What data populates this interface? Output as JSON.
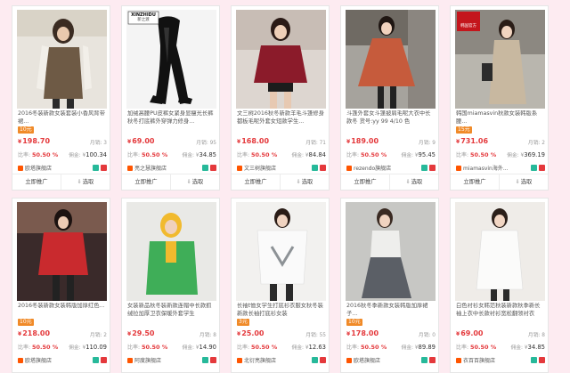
{
  "ui": {
    "commission_ratio_label": "比率:",
    "monthly_sales_label": "月销:",
    "commission_label": "佣金:",
    "promote_button": "立即推广",
    "select_button": "选取"
  },
  "products": [
    {
      "title": "2016冬装新款女装套装小香风背带裙...",
      "badge": "10元",
      "price": "198.70",
      "monthly_sales": "3",
      "ratio": "50.50 %",
      "commission": "100.34",
      "shop": "欧塔旗舰店",
      "has_badge": true
    },
    {
      "title": "加绒高腰PU皮裤女紧身显瘦光长裤秋冬打底裤外穿弹力修身...",
      "badge": "",
      "price": "69.00",
      "monthly_sales": "95",
      "ratio": "50.50 %",
      "commission": "34.85",
      "shop": "亮之慧旗舰店",
      "has_badge": false
    },
    {
      "title": "文三树2016秋冬新款羊毛斗篷修身都板毛呢外套女短款学生...",
      "badge": "",
      "price": "168.00",
      "monthly_sales": "71",
      "ratio": "50.50 %",
      "commission": "84.84",
      "shop": "文三树旗舰店",
      "has_badge": false
    },
    {
      "title": "斗篷外套女斗篷披肩毛呢大衣中长款冬 货号:yy 99 4/10 色",
      "badge": "",
      "price": "189.00",
      "monthly_sales": "9",
      "ratio": "50.50 %",
      "commission": "95.45",
      "shop": "rezendo旗舰店",
      "has_badge": false
    },
    {
      "title": "韩国miamasvin秋款女装韩版系腰...",
      "badge": "15元",
      "price": "731.06",
      "monthly_sales": "2",
      "ratio": "50.50 %",
      "commission": "369.19",
      "shop": "miamasvin海外...",
      "has_badge": true
    },
    {
      "title": "2016冬装新款女装韩版加厚红色...",
      "badge": "10元",
      "price": "218.00",
      "monthly_sales": "2",
      "ratio": "50.50 %",
      "commission": "110.09",
      "shop": "欧塔旗舰店",
      "has_badge": true
    },
    {
      "title": "女装新品秋冬装新款连帽中长款抓绒拉加厚卫衣保暖外套学生",
      "badge": "",
      "price": "29.50",
      "monthly_sales": "8",
      "ratio": "50.50 %",
      "commission": "14.90",
      "shop": "阿度旗舰店",
      "has_badge": false
    },
    {
      "title": "长袖t恤女学生打底衫衣服女秋冬装新款长袖打底衫女装",
      "badge": "3元",
      "price": "25.00",
      "monthly_sales": "55",
      "ratio": "50.50 %",
      "commission": "12.63",
      "shop": "北衍亮旗舰店",
      "has_badge": true
    },
    {
      "title": "2016秋冬季新款女装韩版加厚裙子...",
      "badge": "10元",
      "price": "178.00",
      "monthly_sales": "0",
      "ratio": "50.50 %",
      "commission": "89.89",
      "shop": "欧塔旗舰店",
      "has_badge": true
    },
    {
      "title": "白色衬衫女韩范秋装新款秋季新长袖上衣中长款衬衫宽松翻领衬衣",
      "badge": "",
      "price": "69.00",
      "monthly_sales": "8",
      "ratio": "50.50 %",
      "commission": "34.85",
      "shop": "衣百百旗舰店",
      "has_badge": false
    }
  ],
  "image_overlays": {
    "logo_text": "XINZHIDU",
    "logo_subtext": "新之渡",
    "flag_text": "韩国官方"
  },
  "colors": {
    "price": "#e4393c",
    "badge": "#f08a28",
    "background": "#fdebf1"
  }
}
